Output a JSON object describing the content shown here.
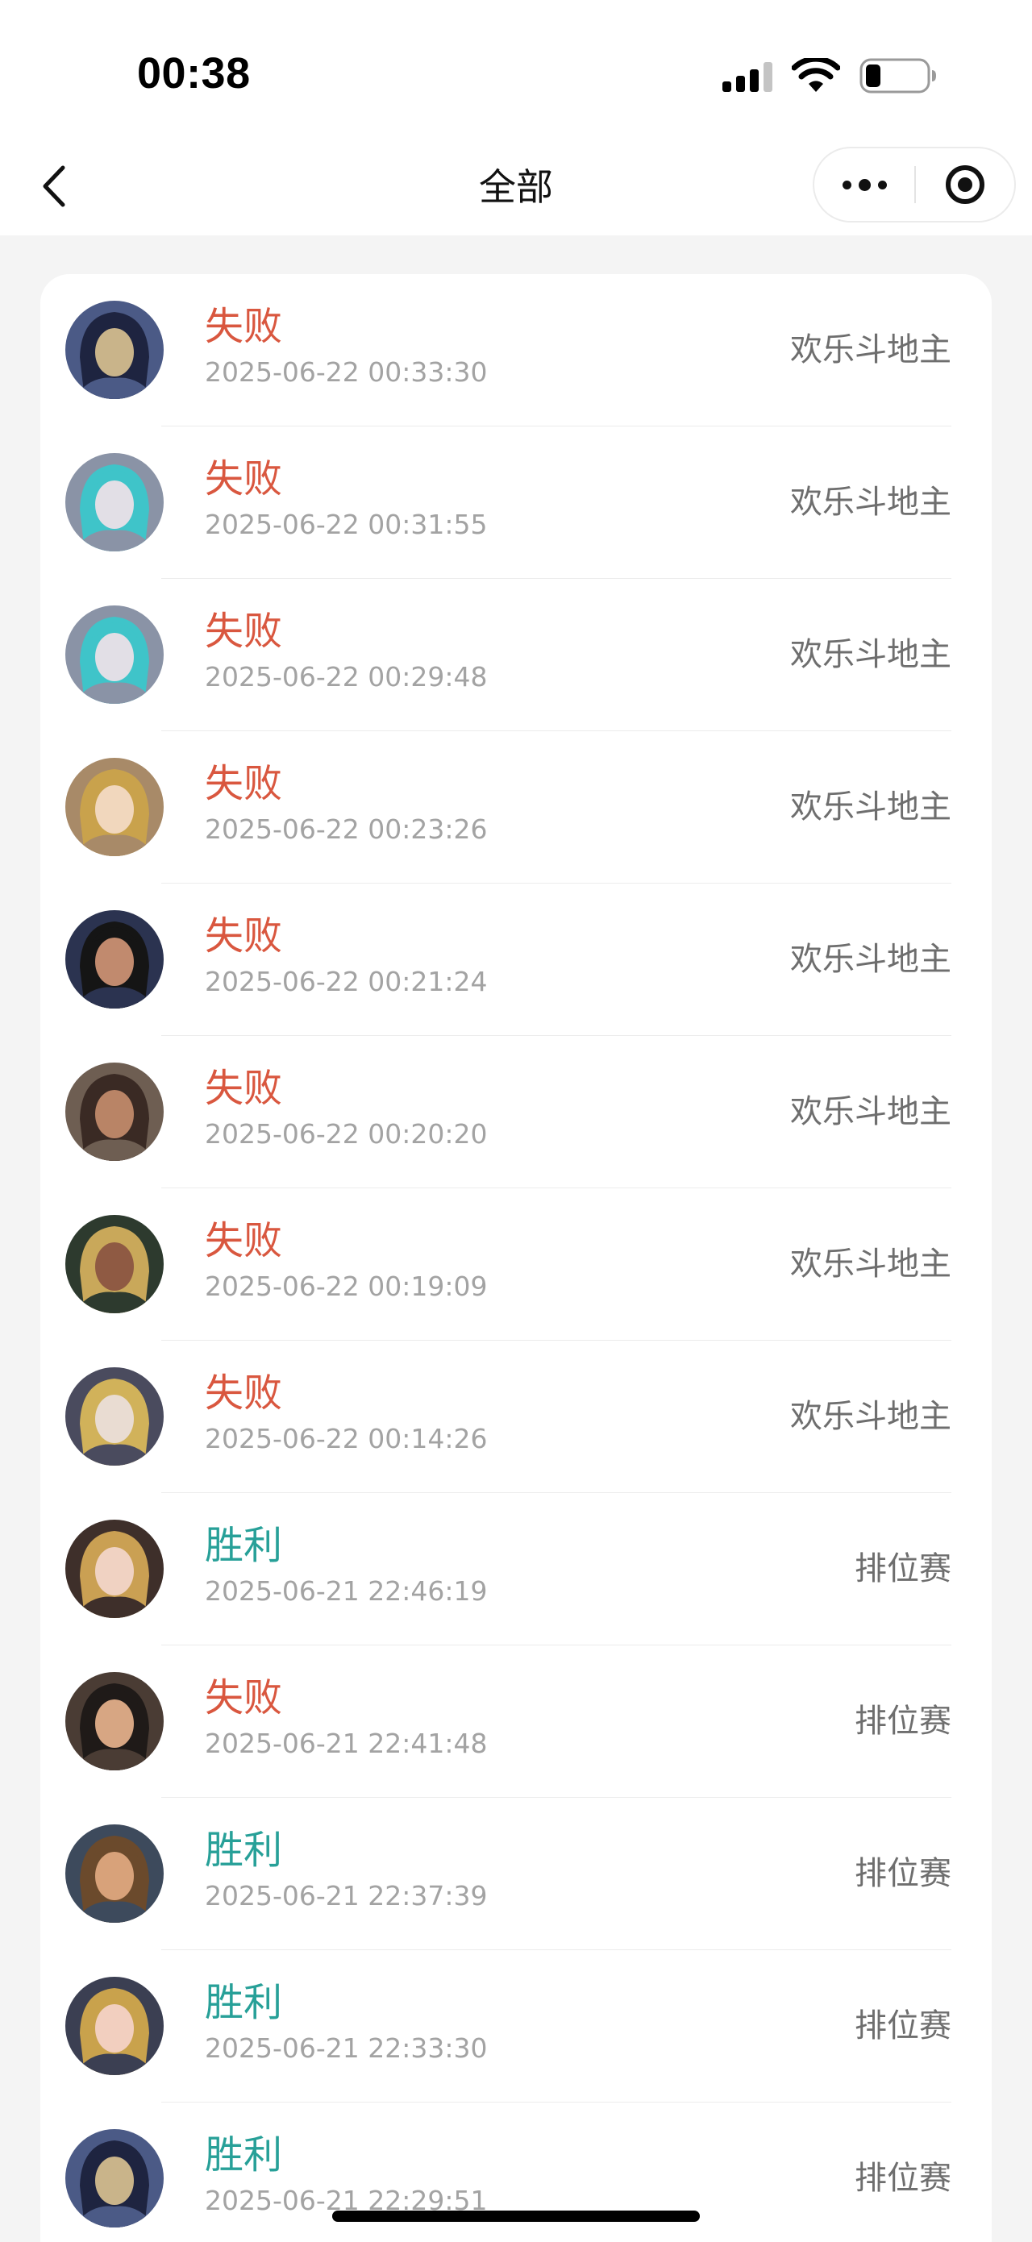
{
  "status_bar": {
    "time": "00:38"
  },
  "nav": {
    "title": "全部"
  },
  "records": [
    {
      "result": "失败",
      "outcome": "lose",
      "datetime": "2025-06-22 00:33:30",
      "mode": "欢乐斗地主",
      "avatar_colors": [
        "#4b5a86",
        "#c9b48a",
        "#1e2440"
      ]
    },
    {
      "result": "失败",
      "outcome": "lose",
      "datetime": "2025-06-22 00:31:55",
      "mode": "欢乐斗地主",
      "avatar_colors": [
        "#8a93a6",
        "#e2dfe6",
        "#3fc4c9"
      ]
    },
    {
      "result": "失败",
      "outcome": "lose",
      "datetime": "2025-06-22 00:29:48",
      "mode": "欢乐斗地主",
      "avatar_colors": [
        "#8a93a6",
        "#e2dfe6",
        "#3fc4c9"
      ]
    },
    {
      "result": "失败",
      "outcome": "lose",
      "datetime": "2025-06-22 00:23:26",
      "mode": "欢乐斗地主",
      "avatar_colors": [
        "#a88a68",
        "#f1d7bd",
        "#c9a24c"
      ]
    },
    {
      "result": "失败",
      "outcome": "lose",
      "datetime": "2025-06-22 00:21:24",
      "mode": "欢乐斗地主",
      "avatar_colors": [
        "#2b3350",
        "#c18a6e",
        "#151515"
      ]
    },
    {
      "result": "失败",
      "outcome": "lose",
      "datetime": "2025-06-22 00:20:20",
      "mode": "欢乐斗地主",
      "avatar_colors": [
        "#6e5e52",
        "#b98466",
        "#3a2a24"
      ]
    },
    {
      "result": "失败",
      "outcome": "lose",
      "datetime": "2025-06-22 00:19:09",
      "mode": "欢乐斗地主",
      "avatar_colors": [
        "#2d3a2e",
        "#8f5a43",
        "#c9a85a"
      ]
    },
    {
      "result": "失败",
      "outcome": "lose",
      "datetime": "2025-06-22 00:14:26",
      "mode": "欢乐斗地主",
      "avatar_colors": [
        "#4a4b5e",
        "#e9dcd2",
        "#d1b25a"
      ]
    },
    {
      "result": "胜利",
      "outcome": "win",
      "datetime": "2025-06-21 22:46:19",
      "mode": "排位赛",
      "avatar_colors": [
        "#3e2f2a",
        "#f0d2c2",
        "#caa053"
      ]
    },
    {
      "result": "失败",
      "outcome": "lose",
      "datetime": "2025-06-21 22:41:48",
      "mode": "排位赛",
      "avatar_colors": [
        "#4a3c34",
        "#d7a683",
        "#1f1a18"
      ]
    },
    {
      "result": "胜利",
      "outcome": "win",
      "datetime": "2025-06-21 22:37:39",
      "mode": "排位赛",
      "avatar_colors": [
        "#3d4a5c",
        "#d8a27a",
        "#6b4a2c"
      ]
    },
    {
      "result": "胜利",
      "outcome": "win",
      "datetime": "2025-06-21 22:33:30",
      "mode": "排位赛",
      "avatar_colors": [
        "#3b3f52",
        "#f2cfbf",
        "#c9a24c"
      ]
    },
    {
      "result": "胜利",
      "outcome": "win",
      "datetime": "2025-06-21 22:29:51",
      "mode": "排位赛",
      "avatar_colors": [
        "#4b5a86",
        "#c9b48a",
        "#1e2440"
      ]
    }
  ],
  "colors": {
    "lose": "#d9573f",
    "win": "#27a098"
  }
}
